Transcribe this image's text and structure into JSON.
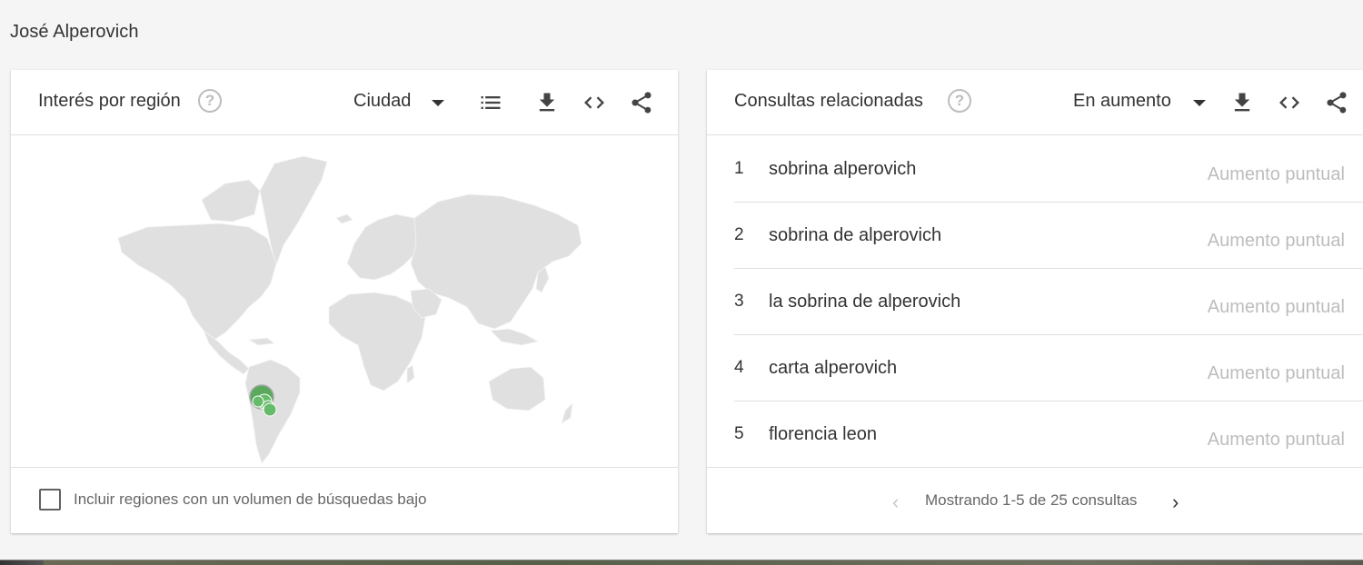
{
  "page": {
    "heading": "José Alperovich"
  },
  "region_card": {
    "title": "Interés por región",
    "resolution_selected": "Ciudad",
    "icons": [
      "help-icon",
      "list-icon",
      "download-icon",
      "embed-icon",
      "share-icon"
    ],
    "map": {
      "bubble_color": "#4caf50",
      "bubble_region": "Argentina"
    },
    "low_volume_checkbox": {
      "label": "Incluir regiones con un volumen de búsquedas bajo",
      "checked": false
    }
  },
  "queries_card": {
    "title": "Consultas relacionadas",
    "filter_selected": "En aumento",
    "icons": [
      "help-icon",
      "download-icon",
      "embed-icon",
      "share-icon"
    ],
    "rows": [
      {
        "rank": "1",
        "query": "sobrina alperovich",
        "value": "Aumento puntual"
      },
      {
        "rank": "2",
        "query": "sobrina de alperovich",
        "value": "Aumento puntual"
      },
      {
        "rank": "3",
        "query": "la sobrina de alperovich",
        "value": "Aumento puntual"
      },
      {
        "rank": "4",
        "query": "carta alperovich",
        "value": "Aumento puntual"
      },
      {
        "rank": "5",
        "query": "florencia leon",
        "value": "Aumento puntual"
      }
    ],
    "pagination": {
      "text": "Mostrando 1-5 de 25 consultas",
      "prev_enabled": false,
      "next_enabled": true
    }
  }
}
